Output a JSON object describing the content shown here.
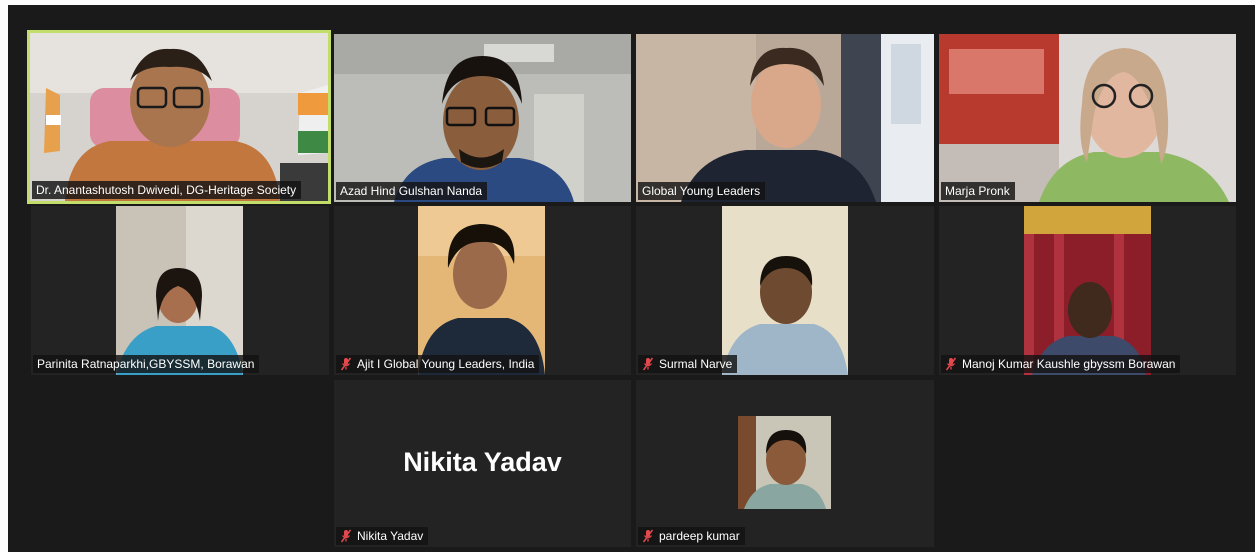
{
  "participants": [
    {
      "name": "Dr. Anantashutosh Dwivedi, DG-Heritage Society",
      "muted": false,
      "active": true
    },
    {
      "name": "Azad Hind Gulshan Nanda",
      "muted": false
    },
    {
      "name": "Global Young Leaders",
      "muted": false
    },
    {
      "name": "Marja Pronk",
      "muted": false
    },
    {
      "name": "Parinita Ratnaparkhi,GBYSSM, Borawan",
      "muted": false
    },
    {
      "name": "Ajit I Global Young Leaders, India",
      "muted": true
    },
    {
      "name": "Surmal Narve",
      "muted": true
    },
    {
      "name": "Manoj Kumar Kaushle gbyssm Borawan",
      "muted": true
    },
    {
      "name": "Nikita Yadav",
      "muted": true,
      "video_off": true
    },
    {
      "name": "pardeep kumar",
      "muted": true
    }
  ],
  "icons": {
    "mute": "mic-muted-icon"
  },
  "colors": {
    "active_speaker_border": "#c3dd6a",
    "mute_icon": "#e5484d",
    "tile_bg": "#232323"
  }
}
